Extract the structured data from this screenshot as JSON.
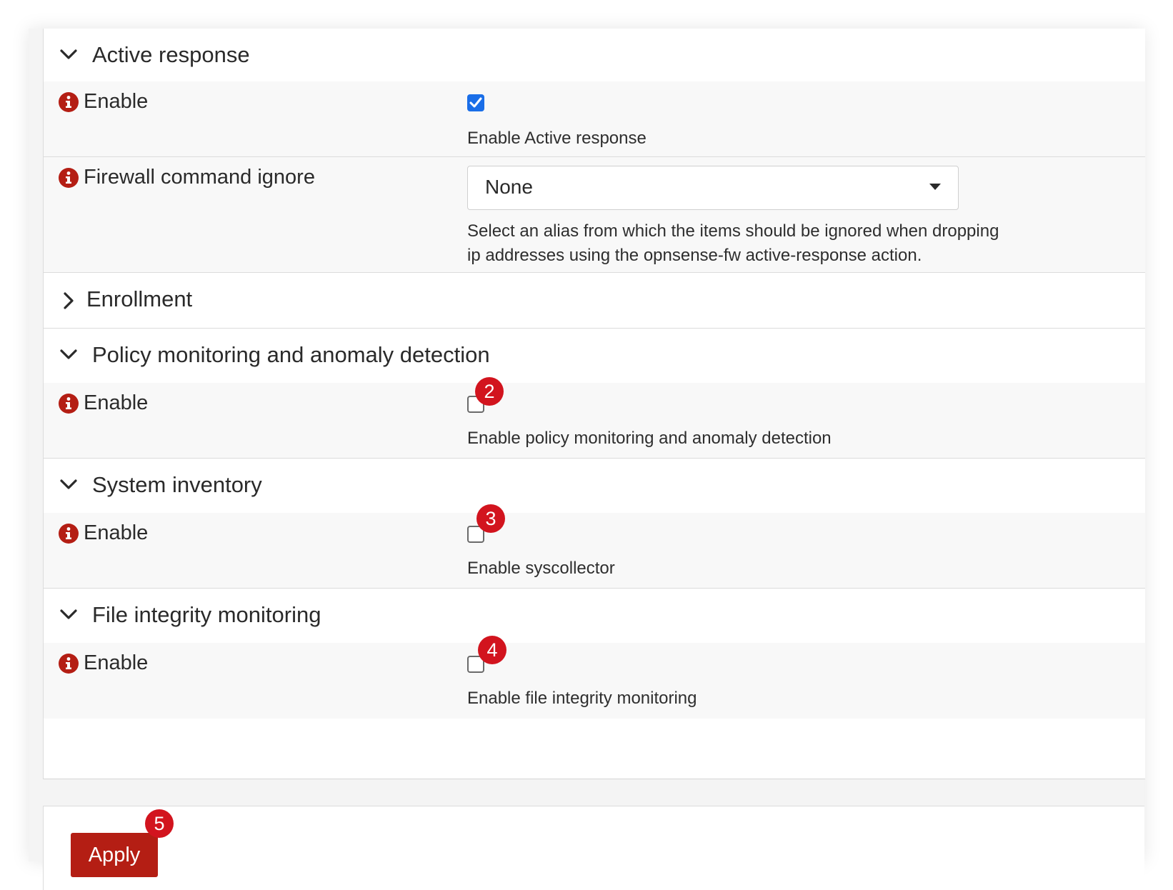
{
  "sections": [
    {
      "title": "Active response",
      "expanded": true,
      "fields": [
        {
          "label": "Enable",
          "checked": true,
          "help": "Enable Active response"
        },
        {
          "label": "Firewall command ignore",
          "select_value": "None",
          "help_line1": "Select an alias from which the items should be ignored when dropping",
          "help_line2": "ip addresses using the opnsense-fw active-response action."
        }
      ]
    },
    {
      "title": "Enrollment",
      "expanded": false
    },
    {
      "title": "Policy monitoring and anomaly detection",
      "expanded": true,
      "fields": [
        {
          "label": "Enable",
          "checked": false,
          "help": "Enable policy monitoring and anomaly detection",
          "badge": "2"
        }
      ]
    },
    {
      "title": "System inventory",
      "expanded": true,
      "fields": [
        {
          "label": "Enable",
          "checked": false,
          "help": "Enable syscollector",
          "badge": "3"
        }
      ]
    },
    {
      "title": "File integrity monitoring",
      "expanded": true,
      "fields": [
        {
          "label": "Enable",
          "checked": false,
          "help": "Enable file integrity monitoring",
          "badge": "4"
        }
      ]
    }
  ],
  "footer": {
    "apply_label": "Apply",
    "badge": "5"
  },
  "icons": {
    "expanded": "chevron-down-icon",
    "collapsed": "chevron-right-icon",
    "info": "info-icon"
  },
  "colors": {
    "accent": "#b41e14",
    "badge": "#d2141e",
    "checkbox": "#1a6ee8"
  }
}
